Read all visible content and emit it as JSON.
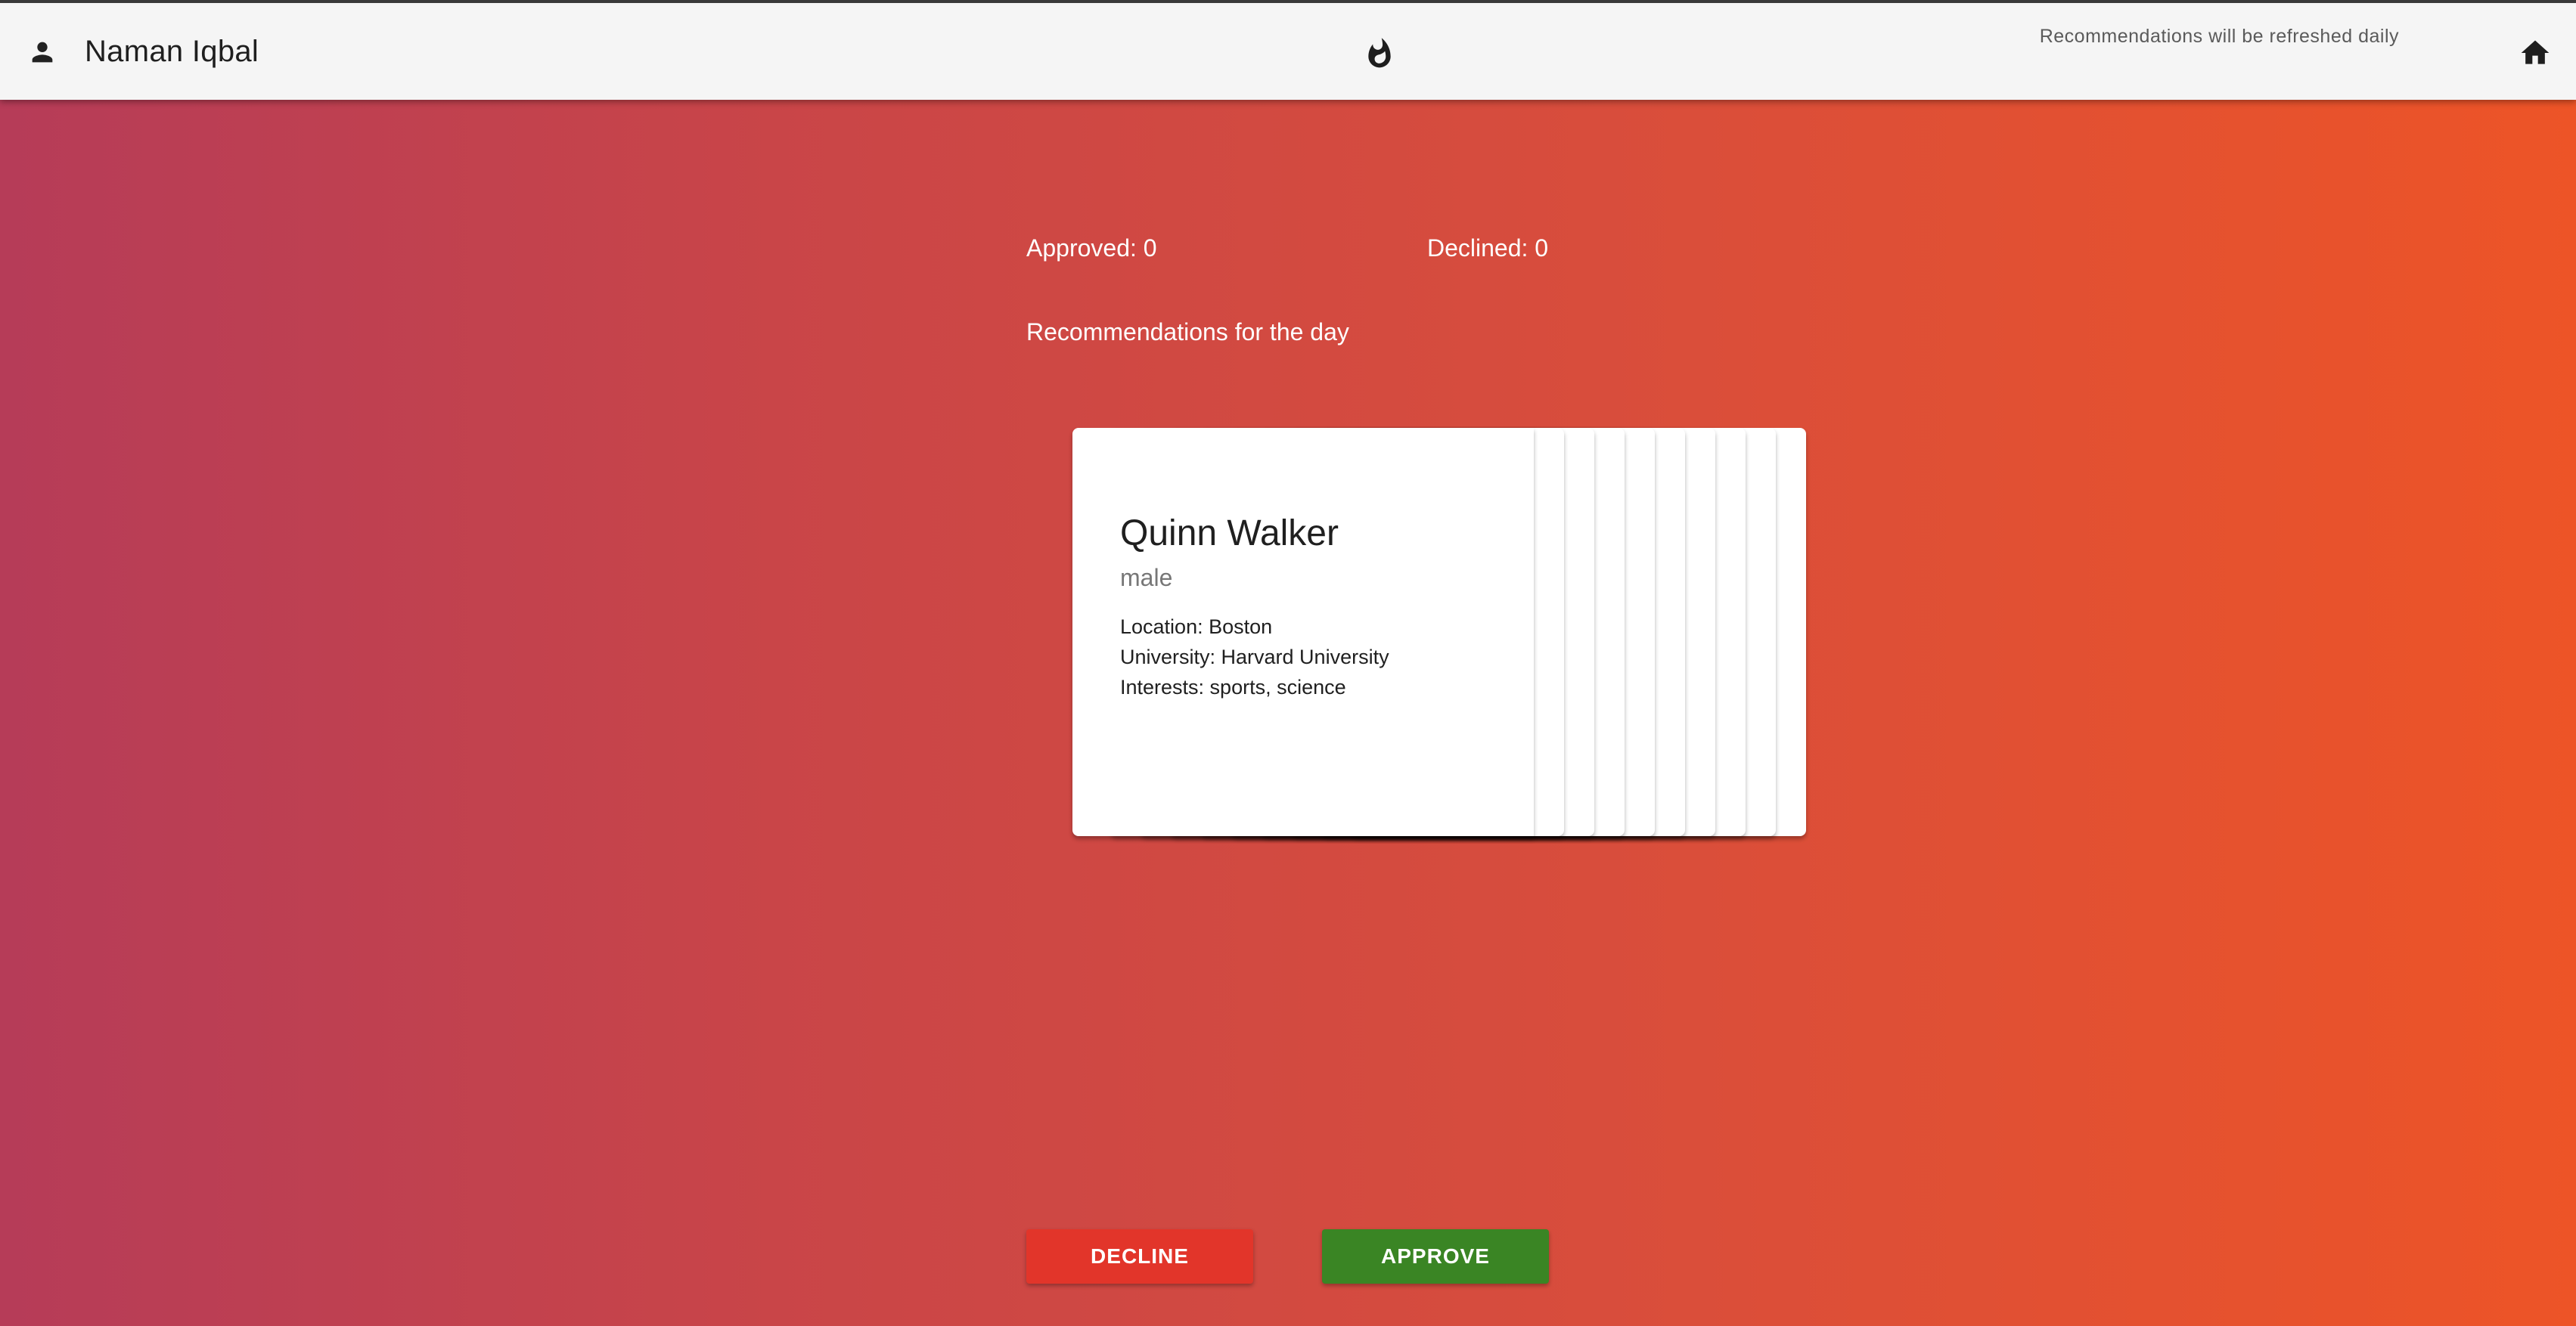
{
  "header": {
    "user_name": "Naman Iqbal",
    "user_icon": "person-icon",
    "logo_icon": "flame-icon",
    "refresh_note": "Recommendations will be refreshed daily",
    "home_icon": "home-icon"
  },
  "stats": {
    "approved_label": "Approved: 0",
    "declined_label": "Declined: 0"
  },
  "section_title": "Recommendations for the day",
  "current_profile": {
    "name": "Quinn Walker",
    "gender": "male",
    "location": "Location: Boston",
    "university": "University: Harvard University",
    "interests": "Interests: sports, science"
  },
  "actions": {
    "decline_label": "DECLINE",
    "approve_label": "APPROVE"
  },
  "colors": {
    "decline": "#e2352a",
    "approve": "#3a8524",
    "background_start": "#b63c58",
    "background_end": "#ed5427"
  }
}
